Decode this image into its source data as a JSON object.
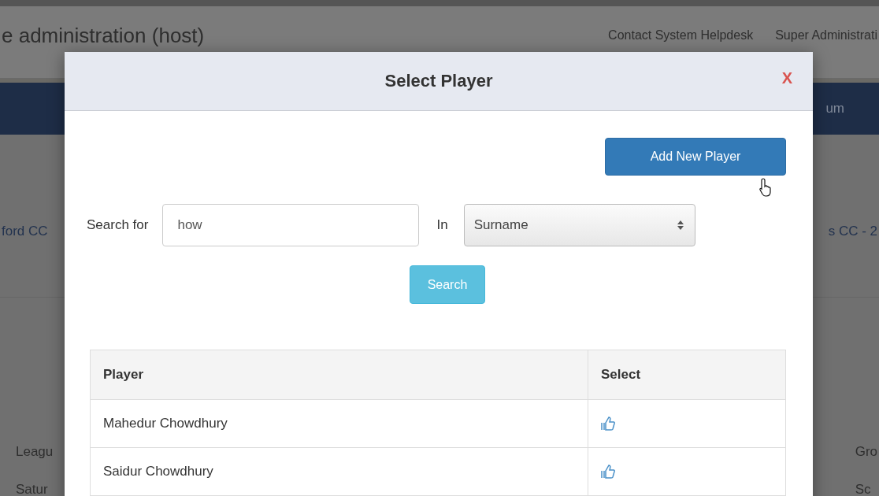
{
  "background": {
    "site_title": "e administration (host)",
    "header_links": [
      "Contact System Helpdesk",
      "Super Administrati"
    ],
    "nav_right": "um",
    "row_left": "ford CC",
    "row_right": "s CC - 2",
    "lower_left": [
      "Leagu",
      "Satur"
    ],
    "lower_right": [
      "Gro",
      "Sc"
    ]
  },
  "modal": {
    "title": "Select Player",
    "close": "X",
    "add_button": "Add New Player",
    "search_label": "Search for",
    "search_value": "how",
    "in_label": "In",
    "field_select": "Surname",
    "search_button": "Search",
    "table": {
      "columns": [
        "Player",
        "Select"
      ],
      "rows": [
        {
          "player": "Mahedur Chowdhury"
        },
        {
          "player": "Saidur Chowdhury"
        }
      ]
    }
  }
}
